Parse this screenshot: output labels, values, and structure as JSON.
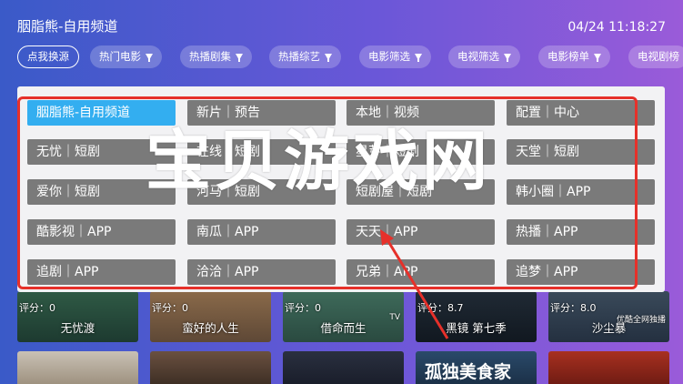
{
  "header": {
    "title": "胭脂熊-自用频道",
    "clock": "04/24 11:18:27"
  },
  "filters": [
    {
      "label": "点我换源",
      "active": true,
      "funnel": false
    },
    {
      "label": "热门电影",
      "active": false,
      "funnel": true
    },
    {
      "label": "热播剧集",
      "active": false,
      "funnel": true
    },
    {
      "label": "热播综艺",
      "active": false,
      "funnel": true
    },
    {
      "label": "电影筛选",
      "active": false,
      "funnel": true
    },
    {
      "label": "电视筛选",
      "active": false,
      "funnel": true
    },
    {
      "label": "电影榜单",
      "active": false,
      "funnel": true
    },
    {
      "label": "电视剧榜",
      "active": false,
      "funnel": false
    }
  ],
  "sources": [
    [
      "胭脂熊-自用频道",
      "新片｜预告",
      "本地｜视频",
      "配置｜中心"
    ],
    [
      "无忧｜短剧",
      "在线｜短剧",
      "星芽｜短剧",
      "天堂｜短剧"
    ],
    [
      "爱你｜短剧",
      "河马｜短剧",
      "短剧屋｜短剧",
      "韩小圈｜APP"
    ],
    [
      "酷影视｜APP",
      "南瓜｜APP",
      "天天｜APP",
      "热播｜APP"
    ],
    [
      "追剧｜APP",
      "洽洽｜APP",
      "兄弟｜APP",
      "追梦｜APP"
    ]
  ],
  "watermark": "宝贝游戏网",
  "cards": [
    {
      "score": "评分：0",
      "title": "无忧渡",
      "tag": ""
    },
    {
      "score": "评分：0",
      "title": "蛮好的人生",
      "tag": ""
    },
    {
      "score": "评分：0",
      "title": "借命而生",
      "tag": "TV"
    },
    {
      "score": "评分：8.7",
      "title": "黑镜 第七季",
      "tag": ""
    },
    {
      "score": "评分：8.0",
      "title": "沙尘暴",
      "tag": "优酷全网独播"
    }
  ],
  "thumbs": [
    {
      "text": ""
    },
    {
      "text": ""
    },
    {
      "text": ""
    },
    {
      "text": "孤独美食家"
    },
    {
      "text": ""
    }
  ],
  "colors": {
    "accent": "#33aef0",
    "overlay_border": "#e6302a",
    "button_bg": "#7a7a7a"
  }
}
